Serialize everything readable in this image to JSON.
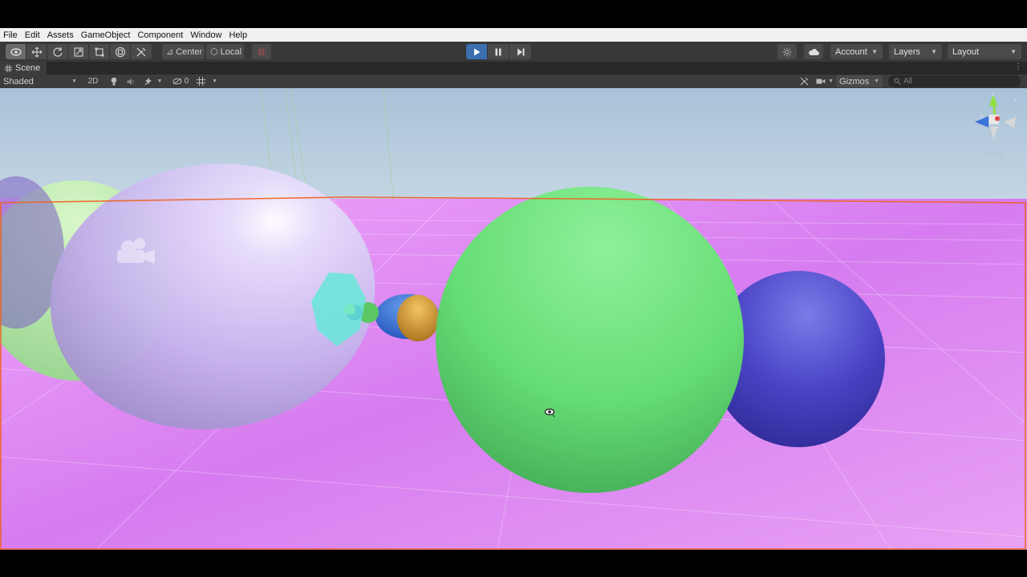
{
  "menu": [
    "File",
    "Edit",
    "Assets",
    "GameObject",
    "Component",
    "Window",
    "Help"
  ],
  "toolbar": {
    "tools": [
      {
        "name": "hand-tool",
        "icon": "eye-icon"
      },
      {
        "name": "move-tool",
        "icon": "move-icon"
      },
      {
        "name": "rotate-tool",
        "icon": "rotate-icon"
      },
      {
        "name": "scale-tool",
        "icon": "scale-icon"
      },
      {
        "name": "rect-tool",
        "icon": "rect-icon"
      },
      {
        "name": "transform-tool",
        "icon": "transform-icon"
      },
      {
        "name": "custom-tool",
        "icon": "wrench-icon"
      }
    ],
    "pivot_mode": "Center",
    "pivot_rotation": "Local",
    "playback": {
      "play": "▶",
      "pause": "❚❚",
      "step": "▶|"
    },
    "account_label": "Account",
    "layers_label": "Layers",
    "layout_label": "Layout"
  },
  "scene_tab": {
    "label": "Scene"
  },
  "scene_toolbar": {
    "draw_mode": "Shaded",
    "mode_2d": "2D",
    "hidden_count": "0",
    "gizmos_label": "Gizmos",
    "search_placeholder": "All"
  },
  "viewport": {
    "projection": "Persp",
    "ground_color": "#e0a0f8",
    "sky_color": "#c8dff0",
    "selection_outline_color": "#f06020"
  }
}
